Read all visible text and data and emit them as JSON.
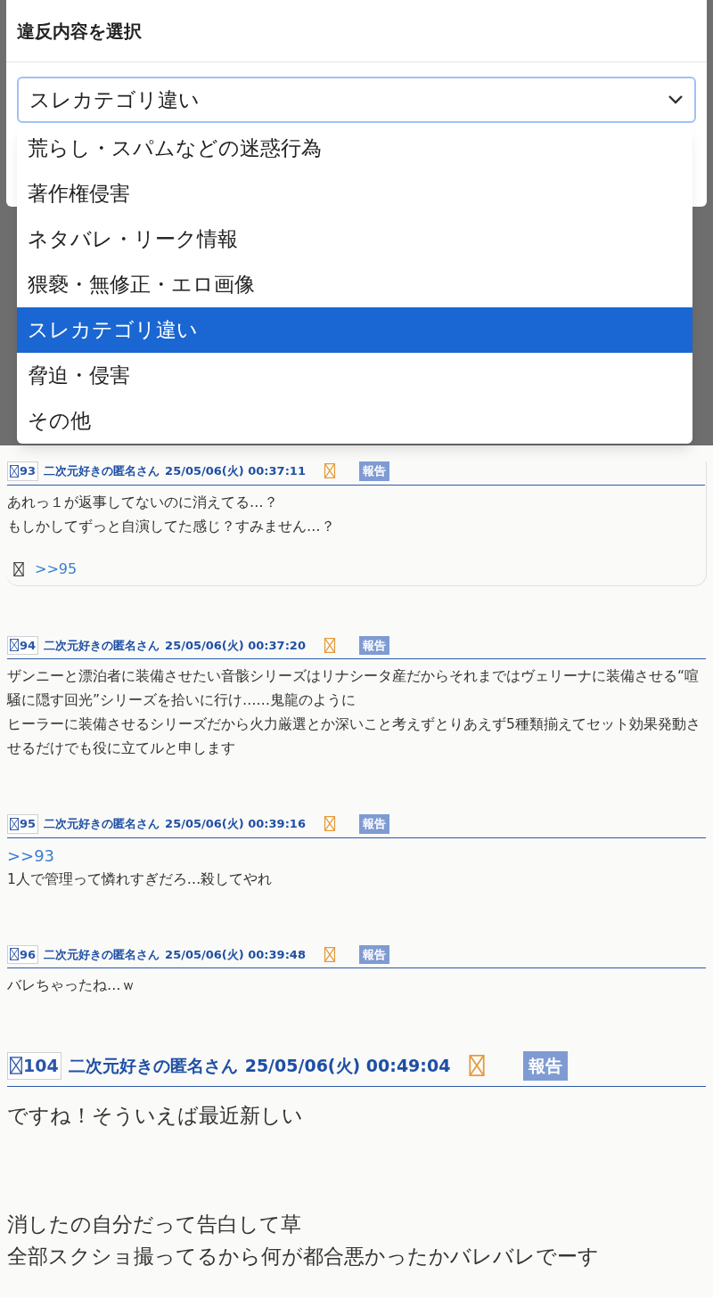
{
  "dialog": {
    "title": "違反内容を選択",
    "select": {
      "value": "スレカテゴリ違い"
    },
    "options": [
      {
        "label": "荒らし・スパムなどの迷惑行為",
        "selected": false
      },
      {
        "label": "著作権侵害",
        "selected": false
      },
      {
        "label": "ネタバレ・リーク情報",
        "selected": false
      },
      {
        "label": "猥褻・無修正・エロ画像",
        "selected": false
      },
      {
        "label": "スレカテゴリ違い",
        "selected": true
      },
      {
        "label": "脅迫・侵害",
        "selected": false
      },
      {
        "label": "その他",
        "selected": false
      }
    ]
  },
  "posts": [
    {
      "number": "93",
      "name": "二次元好きの匿名さん",
      "date": "25/05/06(火) 00:37:11",
      "report": "報告",
      "blocks": [
        {
          "lines": [
            {
              "kind": "text",
              "text": "あれっ１が返事してないのに消えてる…？"
            },
            {
              "kind": "text",
              "text": "もしかしてずっと自演してた感じ？すみません…？"
            }
          ]
        }
      ],
      "replies": [
        ">>95"
      ]
    },
    {
      "number": "94",
      "name": "二次元好きの匿名さん",
      "date": "25/05/06(火) 00:37:20",
      "report": "報告",
      "blocks": [
        {
          "lines": [
            {
              "kind": "text",
              "text": "ザンニーと漂泊者に装備させたい音骸シリーズはリナシータ産だからそれまではヴェリーナに装備させる“喧騒に隠す回光”シリーズを拾いに行け……鬼龍のように"
            },
            {
              "kind": "text",
              "text": "ヒーラーに装備させるシリーズだから火力厳選とか深いこと考えずとりあえず5種類揃えてセット効果発動させるだけでも役に立てルと申します"
            }
          ]
        }
      ]
    },
    {
      "number": "95",
      "name": "二次元好きの匿名さん",
      "date": "25/05/06(火) 00:39:16",
      "report": "報告",
      "blocks": [
        {
          "lines": [
            {
              "kind": "link",
              "text": ">>93"
            },
            {
              "kind": "text",
              "text": "1人で管理って憐れすぎだろ…殺してやれ"
            }
          ]
        }
      ]
    },
    {
      "number": "96",
      "name": "二次元好きの匿名さん",
      "date": "25/05/06(火) 00:39:48",
      "report": "報告",
      "blocks": [
        {
          "lines": [
            {
              "kind": "text",
              "text": "バレちゃったね…ｗ"
            }
          ]
        }
      ]
    },
    {
      "number": "104",
      "name": "二次元好きの匿名さん",
      "date": "25/05/06(火) 00:49:04",
      "report": "報告",
      "blocks": [
        {
          "lines": [
            {
              "kind": "text",
              "text": "ですね！そういえば最近新しい"
            }
          ]
        },
        {
          "lines": [
            {
              "kind": "text",
              "text": "消したの自分だって告白して草"
            },
            {
              "kind": "text",
              "text": "全部スクショ撮ってるから何が都合悪かったかバレバレでーす"
            }
          ]
        }
      ]
    }
  ]
}
